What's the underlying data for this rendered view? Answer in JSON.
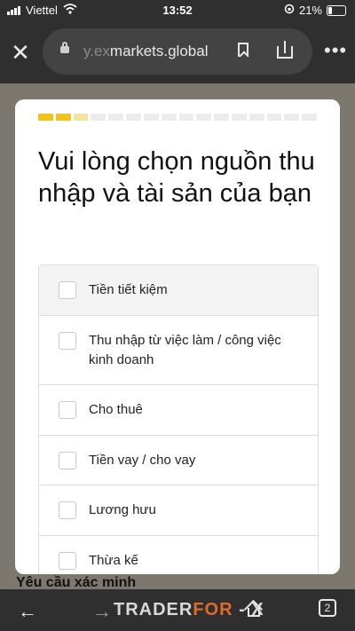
{
  "status_bar": {
    "carrier": "Viettel",
    "time": "13:52",
    "battery": "21%"
  },
  "browser": {
    "url_faded": "y.ex",
    "url_main": "markets.global"
  },
  "modal": {
    "progress": {
      "total_steps": 16,
      "completed_steps": 3,
      "current_partial": 1
    },
    "title": "Vui lòng chọn nguồn thu nhập và tài sản của bạn",
    "options": [
      {
        "label": "Tiền tiết kiệm",
        "checked": false
      },
      {
        "label": "Thu nhập từ việc làm / công việc kinh doanh",
        "checked": false
      },
      {
        "label": "Cho thuê",
        "checked": false
      },
      {
        "label": "Tiền vay / cho vay",
        "checked": false
      },
      {
        "label": "Lương hưu",
        "checked": false
      },
      {
        "label": "Thừa kế",
        "checked": false
      }
    ]
  },
  "page": {
    "bottom_text": "Yêu cầu xác minh"
  },
  "toolbar": {
    "tab_count": "2",
    "watermark_a": "TRADER",
    "watermark_b": "FOR",
    "watermark_c": "X"
  },
  "colors": {
    "accent": "#f2c21f",
    "chrome": "#2f2f2f"
  }
}
